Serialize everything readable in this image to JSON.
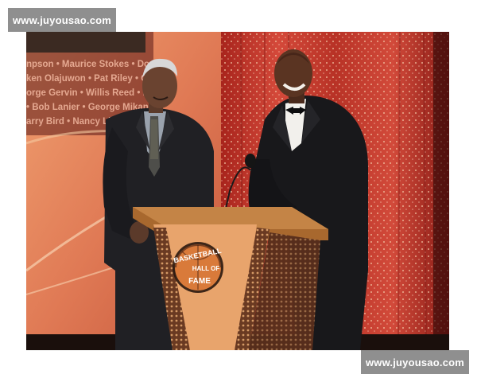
{
  "watermark": {
    "top_text": "www.juyousao.com",
    "bottom_text": "www.juyousao.com"
  },
  "backdrop": {
    "names_line1": "npson • Maurice Stokes • Dom",
    "names_line2": "ken Olajuwon • Pat Riley • C",
    "names_line3": "orge Gervin • Willis Reed • Ea",
    "names_line4": "• Bob Lanier • George Mikan",
    "names_line5": "arry Bird • Nancy Lieb"
  },
  "podium": {
    "logo_line1": "BASKETBALL",
    "logo_line2": "HALL OF",
    "logo_line3": "FAME"
  },
  "colors": {
    "curtain": "#c93c2c",
    "backdrop_left": "#e8875a",
    "podium_wood": "#b87333",
    "podium_panel": "#e6a06a",
    "suit": "#1b1b1e"
  }
}
